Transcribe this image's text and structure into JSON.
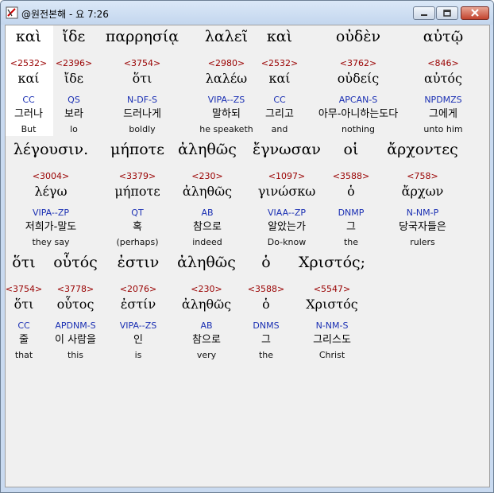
{
  "window": {
    "title": "@원전본해 - 요 7:26",
    "icon": "app-book-icon",
    "buttons": [
      "minimize-icon",
      "maximize-icon",
      "close-icon"
    ],
    "accent_close": "#c3442f"
  },
  "verse": {
    "rows": [
      [
        {
          "greek": "καὶ",
          "strong": "<2532>",
          "lemma": "καί",
          "parse": "CC",
          "korean": "그러나",
          "english": "But"
        },
        {
          "greek": "ἴδε",
          "strong": "<2396>",
          "lemma": "ἴδε",
          "parse": "QS",
          "korean": "보라",
          "english": "lo"
        },
        {
          "greek": "παρρησίᾳ",
          "strong": "<3754>",
          "lemma": "ὅτι",
          "parse": "N-DF-S",
          "korean": "드러나게",
          "english": "boldly"
        },
        {
          "greek": "λαλεῖ",
          "strong": "<2980>",
          "lemma": "λαλέω",
          "parse": "VIPA--ZS",
          "korean": "말하되",
          "english": "he speaketh"
        },
        {
          "greek": "καὶ",
          "strong": "<2532>",
          "lemma": "καί",
          "parse": "CC",
          "korean": "그리고",
          "english": "and"
        },
        {
          "greek": "οὐδὲν",
          "strong": "<3762>",
          "lemma": "οὐδείς",
          "parse": "APCAN-S",
          "korean": "아무-아니하는도다",
          "english": "nothing"
        },
        {
          "greek": "αὐτῷ",
          "strong": "<846>",
          "lemma": "αὐτός",
          "parse": "NPDMZS",
          "korean": "그에게",
          "english": "unto him"
        }
      ],
      [
        {
          "greek": "λέγουσιν.",
          "strong": "<3004>",
          "lemma": "λέγω",
          "parse": "VIPA--ZP",
          "korean": "저희가-말도",
          "english": "they say"
        },
        {
          "greek": "μήποτε",
          "strong": "<3379>",
          "lemma": "μήποτε",
          "parse": "QT",
          "korean": "혹",
          "english": "(perhaps)"
        },
        {
          "greek": "ἀληθῶς",
          "strong": "<230>",
          "lemma": "ἀληθῶς",
          "parse": "AB",
          "korean": "참으로",
          "english": "indeed"
        },
        {
          "greek": "ἔγνωσαν",
          "strong": "<1097>",
          "lemma": "γινώσκω",
          "parse": "VIAA--ZP",
          "korean": "알았는가",
          "english": "Do-know"
        },
        {
          "greek": "οἱ",
          "strong": "<3588>",
          "lemma": "ὁ",
          "parse": "DNMP",
          "korean": "그",
          "english": "the"
        },
        {
          "greek": "ἄρχοντες",
          "strong": "<758>",
          "lemma": "ἄρχων",
          "parse": "N-NM-P",
          "korean": "당국자들은",
          "english": "rulers"
        }
      ],
      [
        {
          "greek": "ὅτι",
          "strong": "<3754>",
          "lemma": "ὅτι",
          "parse": "CC",
          "korean": "줄",
          "english": "that"
        },
        {
          "greek": "οὗτός",
          "strong": "<3778>",
          "lemma": "οὗτος",
          "parse": "APDNM-S",
          "korean": "이 사람을",
          "english": "this"
        },
        {
          "greek": "ἐστιν",
          "strong": "<2076>",
          "lemma": "ἐστίν",
          "parse": "VIPA--ZS",
          "korean": "인",
          "english": "is"
        },
        {
          "greek": "ἀληθῶς",
          "strong": "<230>",
          "lemma": "ἀληθῶς",
          "parse": "AB",
          "korean": "참으로",
          "english": "very"
        },
        {
          "greek": "ὁ",
          "strong": "<3588>",
          "lemma": "ὁ",
          "parse": "DNMS",
          "korean": "그",
          "english": "the"
        },
        {
          "greek": "Χριστός;",
          "strong": "<5547>",
          "lemma": "Χριστός",
          "parse": "N-NM-S",
          "korean": "그리스도",
          "english": "Christ"
        }
      ]
    ]
  }
}
